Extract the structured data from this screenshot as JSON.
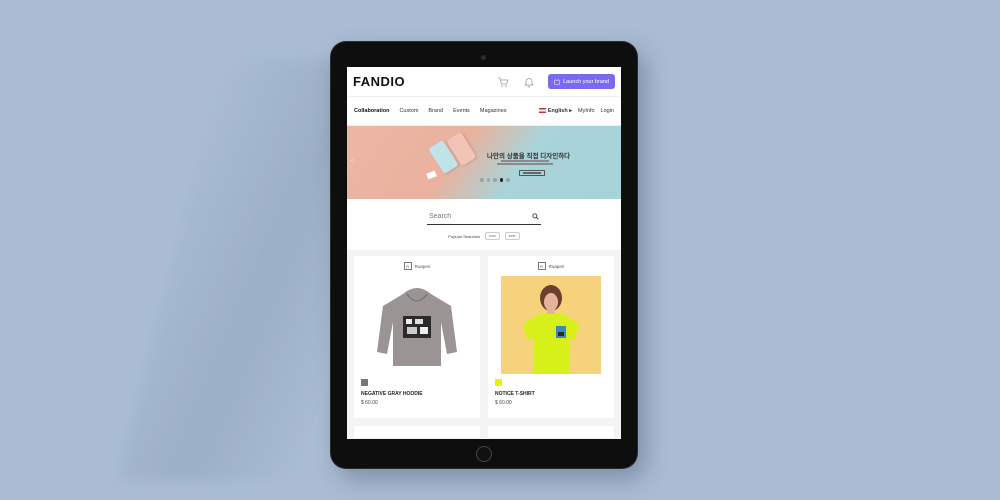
{
  "header": {
    "logo": "FANDIO",
    "launch_label": "Launch your brand",
    "accent": "#7a6af0"
  },
  "nav": {
    "items": [
      "Collaboration",
      "Custom",
      "Brand",
      "Events",
      "Magazines"
    ],
    "language": "English ▸",
    "myinfo": "MyInfo",
    "login": "Login"
  },
  "banner": {
    "title": "나만의 상품을 직접 디자인하다",
    "slide_count": 5,
    "active_slide": 4
  },
  "search": {
    "placeholder": "Search",
    "popular_label": "Popular Searches",
    "popular_terms": [
      "icon",
      "ever"
    ]
  },
  "products": [
    {
      "brand": "Ruaperi",
      "name": "NEGATIVE GRAY HOODIE",
      "price": "$ 60.00",
      "color": "#7c7676"
    },
    {
      "brand": "Ruaperi",
      "name": "NOTICE T-SHIRT",
      "price": "$ 60.00",
      "color": "#e8f00c"
    }
  ],
  "icons": [
    "cart-icon",
    "bell-icon",
    "shirt-icon",
    "search-icon",
    "chevron-left-icon"
  ]
}
